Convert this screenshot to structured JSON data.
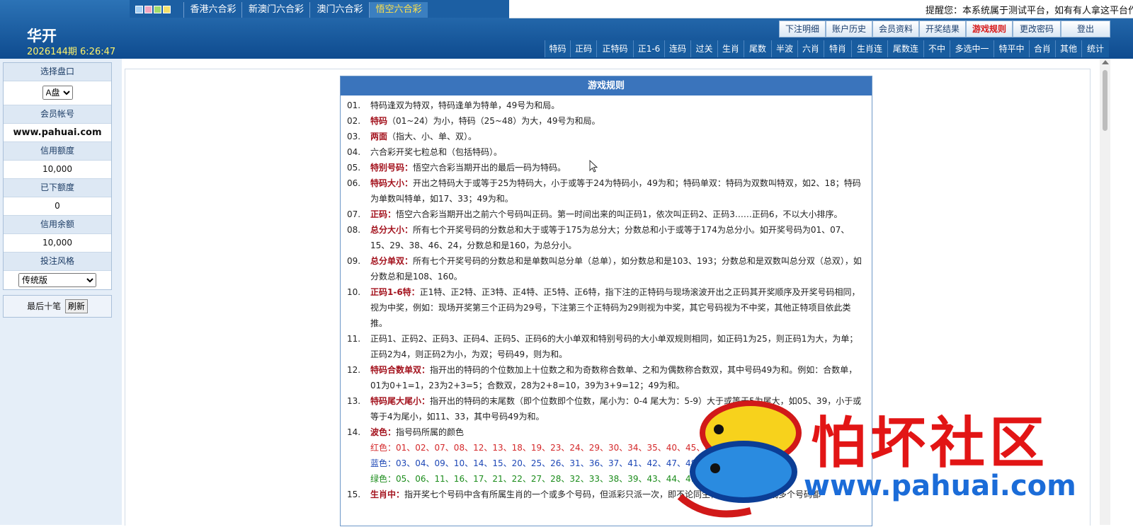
{
  "colors": {
    "accent": "#1c5fa3",
    "active_tab": "#ffe14a",
    "rule_key": "#a3121d",
    "red_ball": "#d4282a",
    "blue_ball": "#1d47b6",
    "green_ball": "#1b8c1b",
    "watermark": "#e21515"
  },
  "lottery_tabs": [
    "香港六合彩",
    "新澳门六合彩",
    "澳门六合彩",
    "悟空六合彩"
  ],
  "notice": "提醒您：本系统属于测试平台，如有有人拿这平台作为",
  "brand": "华开",
  "period": "2026144期 6:26:47",
  "top_buttons": [
    "下注明细",
    "账户历史",
    "会员资料",
    "开奖结果",
    "游戏规则",
    "更改密码",
    "登出"
  ],
  "game_tabs": [
    "特码",
    "正码",
    "正特码",
    "正1-6",
    "连码",
    "过关",
    "生肖",
    "尾数",
    "半波",
    "六肖",
    "特肖",
    "生肖连",
    "尾数连",
    "不中",
    "多选中一",
    "特平中",
    "合肖",
    "其他",
    "统计"
  ],
  "sidebar": {
    "pan_label": "选择盘口",
    "pan_value": "A盘",
    "account_label": "会员帐号",
    "account_value": "www.pahuai.com",
    "credit_label": "信用额度",
    "credit_value": "10,000",
    "placed_label": "已下额度",
    "placed_value": "0",
    "balance_label": "信用余额",
    "balance_value": "10,000",
    "style_label": "投注风格",
    "style_value": "传统版",
    "last_label": "最后十笔",
    "refresh": "刷新"
  },
  "rules": {
    "title": "游戏规则",
    "items": [
      {
        "num": "01.",
        "key": "",
        "text": "特码逢双为特双，特码逢单为特单，49号为和局。"
      },
      {
        "num": "02.",
        "key": "特码",
        "text": "（01~24）为小，特码（25~48）为大，49号为和局。"
      },
      {
        "num": "03.",
        "key": "两面",
        "text": "（指大、小、单、双）。"
      },
      {
        "num": "04.",
        "key": "",
        "text": "六合彩开奖七粒总和（包括特码）。"
      },
      {
        "num": "05.",
        "key": "特别号码：",
        "text": "悟空六合彩当期开出的最后一码为特码。"
      },
      {
        "num": "06.",
        "key": "特码大小：",
        "text": "开出之特码大于或等于25为特码大，小于或等于24为特码小，49为和；特码单双：特码为双数叫特双，如2、18；特码为单数叫特单，如17、33；49为和。"
      },
      {
        "num": "07.",
        "key": "正码：",
        "text": "悟空六合彩当期开出之前六个号码叫正码。第一时间出来的叫正码1，依次叫正码2、正码3……正码6，不以大小排序。"
      },
      {
        "num": "08.",
        "key": "总分大小：",
        "text": "所有七个开奖号码的分数总和大于或等于175为总分大；分数总和小于或等于174为总分小。如开奖号码为01、07、15、29、38、46、24，分数总和是160，为总分小。"
      },
      {
        "num": "09.",
        "key": "总分单双：",
        "text": "所有七个开奖号码的分数总和是单数叫总分单（总单），如分数总和是103、193；分数总和是双数叫总分双（总双），如分数总和是108、160。"
      },
      {
        "num": "10.",
        "key": "正码1-6特：",
        "text": "正1特、正2特、正3特、正4特、正5特、正6特，指下注的正特码与现场滚波开出之正码其开奖顺序及开奖号码相同，视为中奖，例如：现场开奖第三个正码为29号，下注第三个正特码为29则视为中奖，其它号码视为不中奖，其他正特项目依此类推。"
      },
      {
        "num": "11.",
        "key": "",
        "text": "正码1、正码2、正码3、正码4、正码5、正码6的大小单双和特别号码的大小单双规则相同，如正码1为25，则正码1为大，为单；正码2为4，则正码2为小，为双；号码49，则为和。"
      },
      {
        "num": "12.",
        "key": "特码合数单双：",
        "text": "指开出的特码的个位数加上十位数之和为奇数称合数单、之和为偶数称合数双，其中号码49为和。例如：合数单，01为0+1=1，23为2+3=5；合数双，28为2+8=10，39为3+9=12；49为和。"
      },
      {
        "num": "13.",
        "key": "特码尾大尾小：",
        "text": "指开出的特码的末尾数（即个位数即个位数，尾小为：0-4 尾大为：5-9）大于或等于5为尾大，如05、39，小于或等于4为尾小，如11、33，其中号码49为和。"
      },
      {
        "num": "14.",
        "key": "波色：",
        "text": "指号码所属的颜色"
      }
    ],
    "red_line": "红色：01、02、07、08、12、13、18、19、23、24、29、30、34、35、40、45、46",
    "blue_line": "蓝色：03、04、09、10、14、15、20、25、26、31、36、37、41、42、47、48",
    "green_line": "绿色：05、06、11、16、17、21、22、27、28、32、33、38、39、43、44、49",
    "item15_num": "15.",
    "item15_key": "生肖中：",
    "item15_text": "指开奖七个号码中含有所属生肖的一个或多个号码，但派彩只派一次，即不论同生肖号码出现一个或多个号码都"
  },
  "watermark": {
    "text": "怕坏社区",
    "url": "www.pahuai.com"
  }
}
